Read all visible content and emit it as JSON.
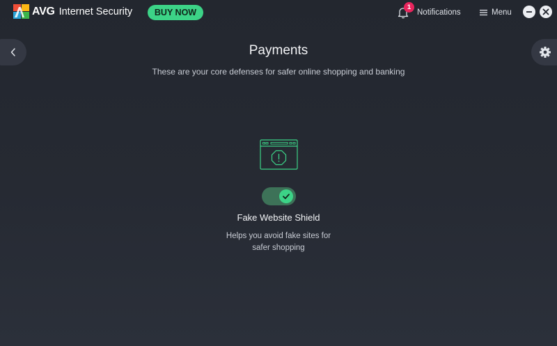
{
  "app": {
    "brand": "AVG",
    "product": "Internet Security",
    "logo_icon": "avg-logo-icon"
  },
  "header": {
    "buy_now_label": "BUY NOW",
    "notifications": {
      "icon": "bell-icon",
      "badge_count": "1",
      "label": "Notifications"
    },
    "menu": {
      "icon": "hamburger-icon",
      "label": "Menu"
    },
    "window_controls": [
      "minimize-icon",
      "close-icon"
    ]
  },
  "navigation": {
    "back_icon": "chevron-left-icon",
    "settings_icon": "gear-icon"
  },
  "page": {
    "title": "Payments",
    "subtitle": "These are your core defenses for safer online shopping and banking"
  },
  "feature": {
    "icon": "browser-alert-icon",
    "enabled": true,
    "name": "Fake Website Shield",
    "description_line1": "Helps you avoid fake sites for",
    "description_line2": "safer shopping"
  },
  "colors": {
    "accent_green": "#3cd387",
    "toggle_track": "#3d7258",
    "badge_red": "#e8255d",
    "background": "#23272f"
  }
}
